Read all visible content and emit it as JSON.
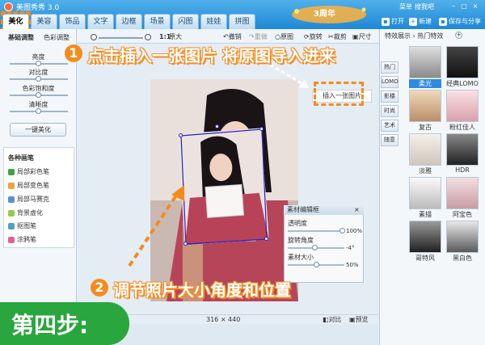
{
  "window": {
    "title": "美图秀秀 3.0"
  },
  "tabs": [
    "美化",
    "美容",
    "饰品",
    "文字",
    "边框",
    "场景",
    "闪图",
    "娃娃",
    "拼图"
  ],
  "banner": {
    "text": "3周年"
  },
  "top_links": {
    "menu": "菜单",
    "feedback": "搜我吧"
  },
  "top_buttons": {
    "open": "打开",
    "new": "新建",
    "save": "保存与分享"
  },
  "left_panel": {
    "subtabs": [
      "基础调整",
      "色彩调整"
    ],
    "sliders": [
      "亮度",
      "对比度",
      "色彩饱和度",
      "清晰度"
    ],
    "onekey": "一键美化",
    "brush_title": "各种画笔",
    "brushes": [
      "局部彩色笔",
      "局部变色笔",
      "局部马赛克",
      "背景虚化",
      "抠图笔",
      "涂鸦笔"
    ]
  },
  "toolbar": {
    "zoom": "1:1",
    "original": "原大",
    "undo": "撤销",
    "redo": "重做",
    "reset": "原图",
    "rotate": "旋转",
    "crop": "裁剪",
    "size": "尺寸"
  },
  "insert_button": "插入一张图片",
  "editor": {
    "title": "素材编辑框",
    "close": "×",
    "fields": [
      {
        "label": "透明度",
        "value": "100%"
      },
      {
        "label": "旋转角度",
        "value": "-4°"
      },
      {
        "label": "素材大小",
        "value": "50%"
      }
    ]
  },
  "status": {
    "dims": "316 × 440",
    "compare": "对比",
    "preview": "预览"
  },
  "right_panel": {
    "header": "特效展示 › 热门特效",
    "tabs": [
      "热门",
      "LOMO",
      "影楼",
      "时尚",
      "艺术",
      "随意"
    ],
    "effects": [
      "柔光",
      "经典LOMO",
      "复古",
      "粉红佳人",
      "淡雅",
      "HDR",
      "素描",
      "阿宝色",
      "哥特风",
      "黑白色"
    ]
  },
  "overlay": {
    "step1_num": "1",
    "step1": "点击插入一张图片 将原图导入进来",
    "step2_num": "2",
    "step2": "调节照片大小角度和位置",
    "step_label": "第四步:"
  },
  "colors": {
    "accent": "#f58b1e",
    "titlebar": "#1f88d6",
    "step_banner": "#2aa63e"
  }
}
